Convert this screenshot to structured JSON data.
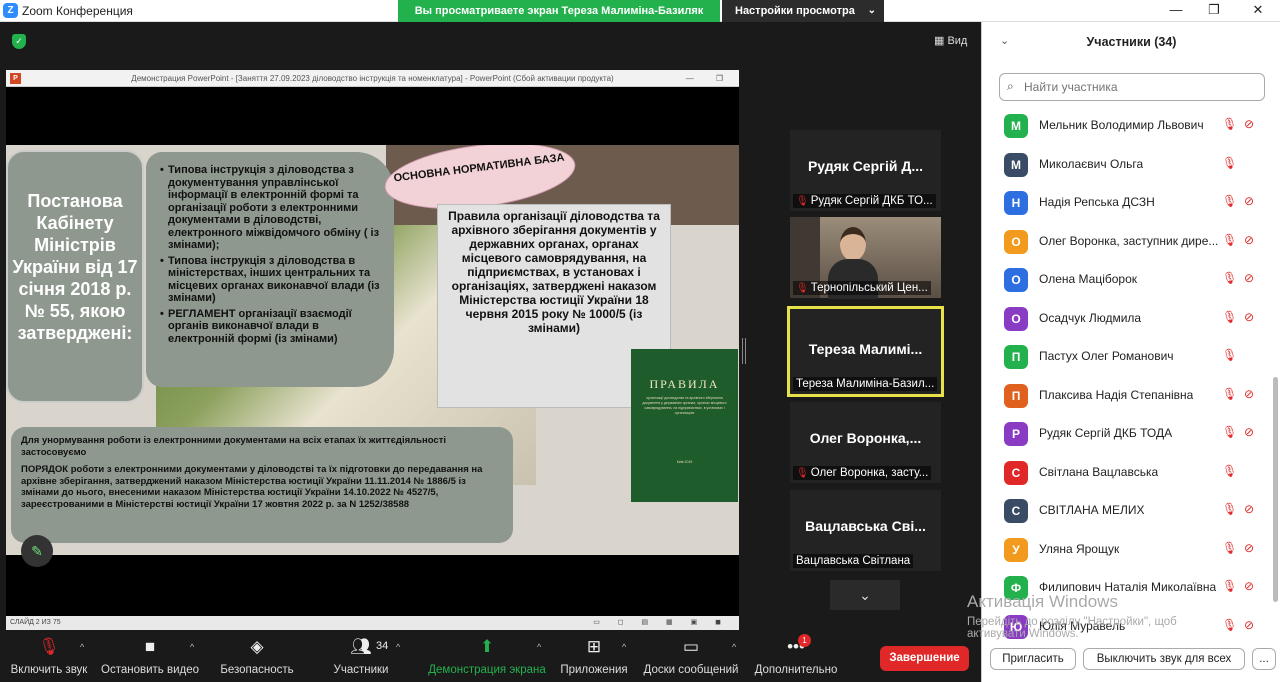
{
  "window": {
    "title": "Zoom Конференция",
    "share_banner": "Вы просматриваете экран Тереза Малимiна-Базиляк",
    "view_options": "Настройки просмотра",
    "minimize": "—",
    "maximize": "❐",
    "close": "✕"
  },
  "view_button": "Вид",
  "powerpoint": {
    "title": "Демонстрация PowerPoint - [Заняття 27.09.2023 діловодство інструкція та номенклатура] - PowerPoint (Сбой активации продукта)",
    "status": "СЛАЙД 2 ИЗ 75",
    "slide": {
      "left_box": "Постанова Кабінету Міністрів України від 17 січня 2018 р. № 55, якою затверджені:",
      "list_items": [
        "Типова інструкція з діловодства з документування управлінської інформації в електронній формі та організації роботи з електронними документами в діловодстві, електронного міжвідомчого обміну ( із змінами);",
        "Типова інструкція з діловодства в міністерствах, інших центральних та місцевих органах виконавчої влади (із змінами)",
        "РЕГЛАМЕНТ організації взаємодії органів виконавчої влади в електронній формі (із змінами)"
      ],
      "oval": "ОСНОВНА НОРМАТИВНА БАЗА",
      "right_box": "Правила організації діловодства та архівного зберігання документів у державних органах, органах місцевого самоврядування, на підприємствах, в установах і організаціях, затверджені наказом Міністерства юстиції України 18 червня 2015 року № 1000/5 (із змінами)",
      "bottom_p1": "Для унормування роботи із електронними документами на всіх етапах їх життєдіяльності застосовуємо",
      "bottom_p2": "ПОРЯДОК роботи з електронними документами у діловодстві та їх підготовки до передавання на архівне зберігання, затверджений наказом Міністерства юстиції України 11.11.2014 № 1886/5 із змінами до нього, внесеними наказом Міністерства юстиції України 14.10.2022 № 4527/5, зареєстрованими в Міністерстві юстиції України 17 жовтня 2022 р. за N 1252/38588",
      "book_title": "ПРАВИЛА",
      "book_sub": "організації діловодства та архівного зберігання документів у державних органах, органах місцевого самоврядування, на підприємствах, в установах і організаціях",
      "book_footer": "Київ 2015"
    }
  },
  "thumbnails": [
    {
      "big": "Рудяк Сергій Д...",
      "small": "Рудяк Сергій ДКБ ТО...",
      "muted": true
    },
    {
      "big": "",
      "small": "Тернопільський Цен...",
      "muted": true
    },
    {
      "big": "Тереза Малимі...",
      "small": "Тереза Малимiна-Базил...",
      "muted": false
    },
    {
      "big": "Олег Воронка,...",
      "small": "Олег Воронка, засту...",
      "muted": true
    },
    {
      "big": "Вацлавська Свi...",
      "small": "Вацлавська Свiтлана",
      "muted": false
    }
  ],
  "toolbar": {
    "audio": "Включить звук",
    "video": "Остановить видео",
    "security": "Безопасность",
    "participants": "Участники",
    "participants_count": "34",
    "share": "Демонстрация экрана",
    "apps": "Приложения",
    "whiteboards": "Доски сообщений",
    "more": "Дополнительно",
    "more_badge": "1",
    "end": "Завершение"
  },
  "panel": {
    "title": "Участники (34)",
    "search_placeholder": "Найти участника",
    "participants": [
      {
        "initial": "М",
        "name": "Мельник Володимир Львович",
        "color": "#23b14d",
        "cam_off": true
      },
      {
        "initial": "М",
        "name": "Миколаєвич Ольга",
        "color": "#3a4b66",
        "cam_off": false
      },
      {
        "initial": "Н",
        "name": "Надія Репська ДСЗН",
        "color": "#2d6ee0",
        "cam_off": true
      },
      {
        "initial": "О",
        "name": "Олег Воронка, заступник дире...",
        "color": "#f29a1e",
        "cam_off": true
      },
      {
        "initial": "О",
        "name": "Олена Мацiборок",
        "color": "#2d6ee0",
        "cam_off": true
      },
      {
        "initial": "О",
        "name": "Осадчук Людмила",
        "color": "#8a3bc4",
        "cam_off": true
      },
      {
        "initial": "П",
        "name": "Пастух Олег Романович",
        "color": "#23b14d",
        "cam_off": false
      },
      {
        "initial": "П",
        "name": "Плаксива Надія Степанівна",
        "color": "#e0601e",
        "cam_off": true
      },
      {
        "initial": "Р",
        "name": "Рудяк Сергій ДКБ ТОДА",
        "color": "#8a3bc4",
        "cam_off": true
      },
      {
        "initial": "С",
        "name": "Світлана  Вацлавська",
        "color": "#e02828",
        "cam_off": false
      },
      {
        "initial": "С",
        "name": "СВIТЛАНА МЕЛИХ",
        "color": "#3a4b66",
        "cam_off": true
      },
      {
        "initial": "У",
        "name": "Уляна Ярощук",
        "color": "#f29a1e",
        "cam_off": true
      },
      {
        "initial": "Ф",
        "name": "Филипович Наталія Миколаївна",
        "color": "#23b14d",
        "cam_off": true
      },
      {
        "initial": "Ю",
        "name": "Юлія Муравель",
        "color": "#8a3bc4",
        "cam_off": true
      }
    ],
    "invite": "Пригласить",
    "mute_all": "Выключить звук для всех",
    "more": "..."
  },
  "activation": {
    "line1": "Активація Windows",
    "line2": "Перейдіть до розділу \"Настройки\", щоб",
    "line3": "активувати Windows."
  }
}
